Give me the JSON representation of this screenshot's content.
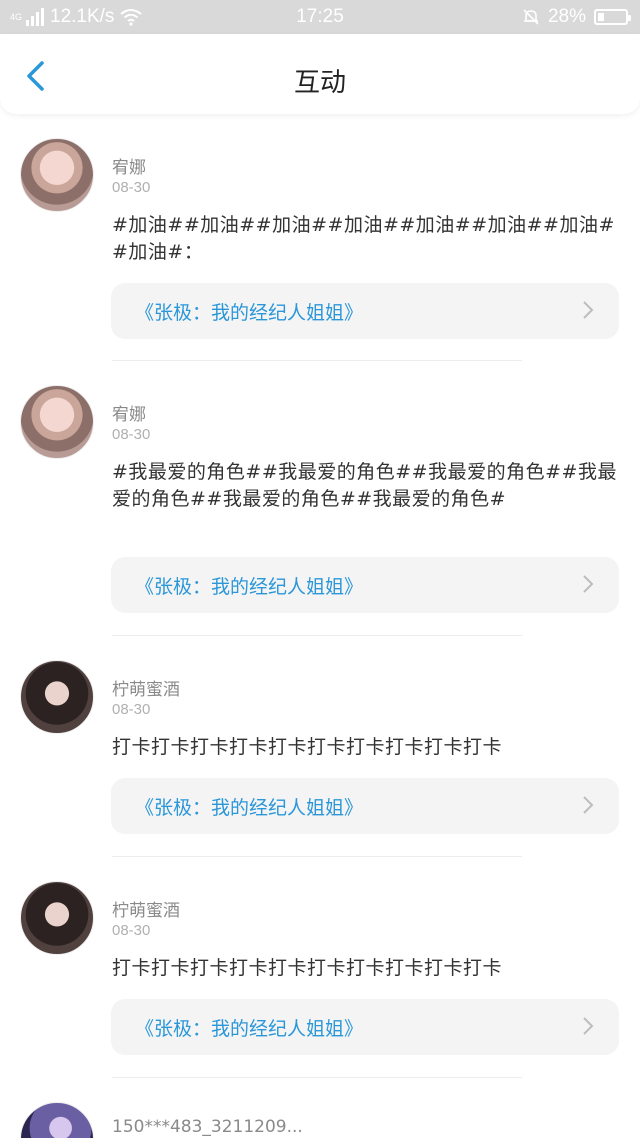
{
  "status_bar": {
    "network_speed": "12.1K/s",
    "time": "17:25",
    "battery": "28%",
    "network_tag": "4G",
    "icons": [
      "signal-icon",
      "wifi-icon",
      "mute-bell-icon",
      "battery-icon"
    ]
  },
  "header": {
    "title": "互动",
    "back_icon": "chevron-left-icon",
    "accent_color": "#2b97d9"
  },
  "posts": [
    {
      "username": "宥娜",
      "date": "08-30",
      "content": "#加油##加油##加油##加油##加油##加油##加油##加油#：",
      "link": "《张极：我的经纪人姐姐》"
    },
    {
      "username": "宥娜",
      "date": "08-30",
      "content": "#我最爱的角色##我最爱的角色##我最爱的角色##我最爱的角色##我最爱的角色##我最爱的角色#",
      "link": "《张极：我的经纪人姐姐》"
    },
    {
      "username": "柠萌蜜酒",
      "date": "08-30",
      "content": "打卡打卡打卡打卡打卡打卡打卡打卡打卡打卡",
      "link": "《张极：我的经纪人姐姐》"
    },
    {
      "username": "柠萌蜜酒",
      "date": "08-30",
      "content": "打卡打卡打卡打卡打卡打卡打卡打卡打卡打卡",
      "link": "《张极：我的经纪人姐姐》"
    },
    {
      "username": "150***483_3211209..."
    }
  ]
}
